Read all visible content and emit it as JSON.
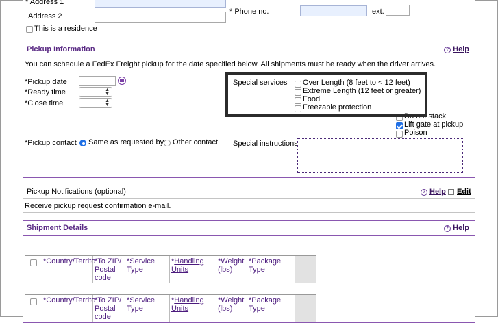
{
  "address": {
    "address1_label": "* Address 1",
    "address2_label": "Address 2",
    "residence_label": "This is a residence",
    "residence_checked": false,
    "phone_label": "* Phone no.",
    "ext_label": "ext."
  },
  "pickup_info": {
    "title": "Pickup Information",
    "help_label": "Help",
    "description": "You can schedule a FedEx Freight pickup for the date specified below. All shipments must be ready when the driver arrives.",
    "pickup_date_label": "*Pickup date",
    "ready_time_label": "*Ready time",
    "close_time_label": "*Close time",
    "special_services_label": "Special services",
    "services": [
      {
        "label": "Over Length (8 feet to < 12 feet)",
        "checked": false
      },
      {
        "label": "Extreme Length (12 feet or greater)",
        "checked": false
      },
      {
        "label": "Food",
        "checked": false
      },
      {
        "label": "Freezable protection",
        "checked": false
      }
    ],
    "extra_services": [
      {
        "label": "Do not stack",
        "checked": false
      },
      {
        "label": "Lift gate at pickup",
        "checked": true
      },
      {
        "label": "Poison",
        "checked": false
      }
    ],
    "pickup_contact_label": "*Pickup contact",
    "contact_options": [
      {
        "label": "Same as requested by",
        "selected": true
      },
      {
        "label": "Other contact",
        "selected": false
      }
    ],
    "special_instructions_label": "Special instructions"
  },
  "notifications": {
    "title": "Pickup Notifications (optional)",
    "help_label": "Help",
    "edit_label": "Edit",
    "body": "Receive pickup request confirmation e-mail."
  },
  "shipment": {
    "title": "Shipment Details",
    "help_label": "Help",
    "columns": [
      {
        "lines": [
          "*Country/Territo"
        ],
        "link": false
      },
      {
        "lines": [
          "*To ZIP/",
          "Postal",
          "code"
        ],
        "link": false
      },
      {
        "lines": [
          "*Service",
          "Type"
        ],
        "link": false
      },
      {
        "lines": [
          "*",
          "Handling",
          "Units"
        ],
        "link": true
      },
      {
        "lines": [
          "*Weight",
          "(lbs)"
        ],
        "link": false
      },
      {
        "lines": [
          "*Package",
          "Type"
        ],
        "link": false
      }
    ]
  },
  "colors": {
    "panel_border": "#8a57b0",
    "title_purple": "#5a2a84",
    "checkbox_blue": "#1f6fe5",
    "highlight_box": "#2b2b2b"
  }
}
